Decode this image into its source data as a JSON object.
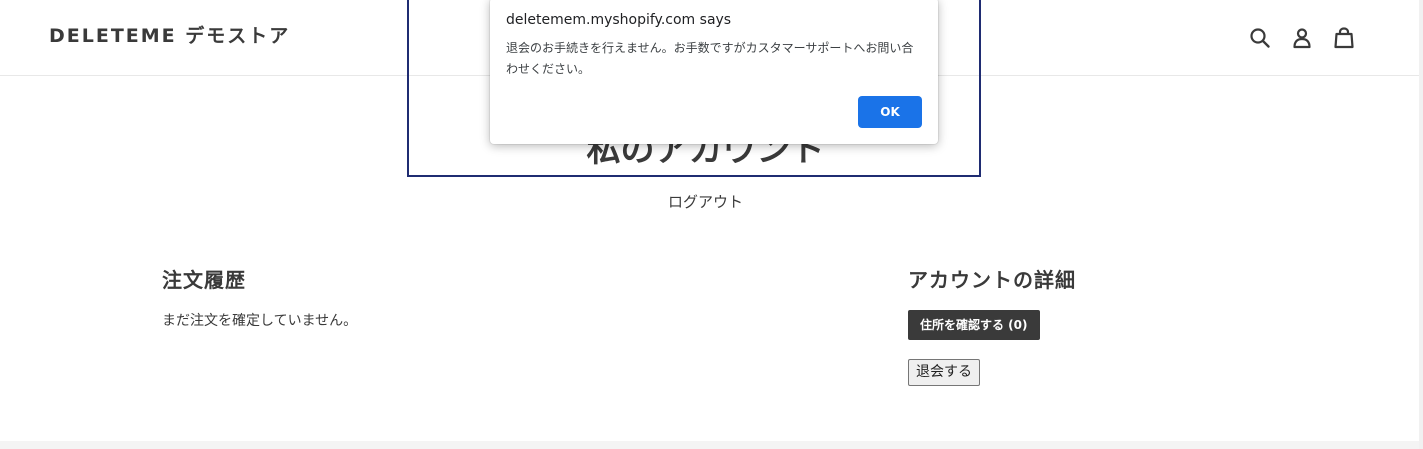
{
  "header": {
    "logo": "DELETEME デモストア",
    "icons": [
      "search-icon",
      "account-icon",
      "cart-icon"
    ]
  },
  "main": {
    "title": "私のアカウント",
    "logout": "ログアウト"
  },
  "orders": {
    "heading": "注文履歴",
    "empty_text": "まだ注文を確定していません。"
  },
  "account": {
    "heading": "アカウントの詳細",
    "address_button": "住所を確認する (0)",
    "withdraw_button": "退会する"
  },
  "alert": {
    "origin": "deletemem.myshopify.com says",
    "message": "退会のお手続きを行えません。お手数ですがカスタマーサポートへお問い合わせください。",
    "ok_label": "OK"
  },
  "colors": {
    "text": "#3a3a3a",
    "focus_outline": "#1f2c72",
    "dialog_button": "#1a73e8",
    "dark_button": "#3a3a3a"
  }
}
